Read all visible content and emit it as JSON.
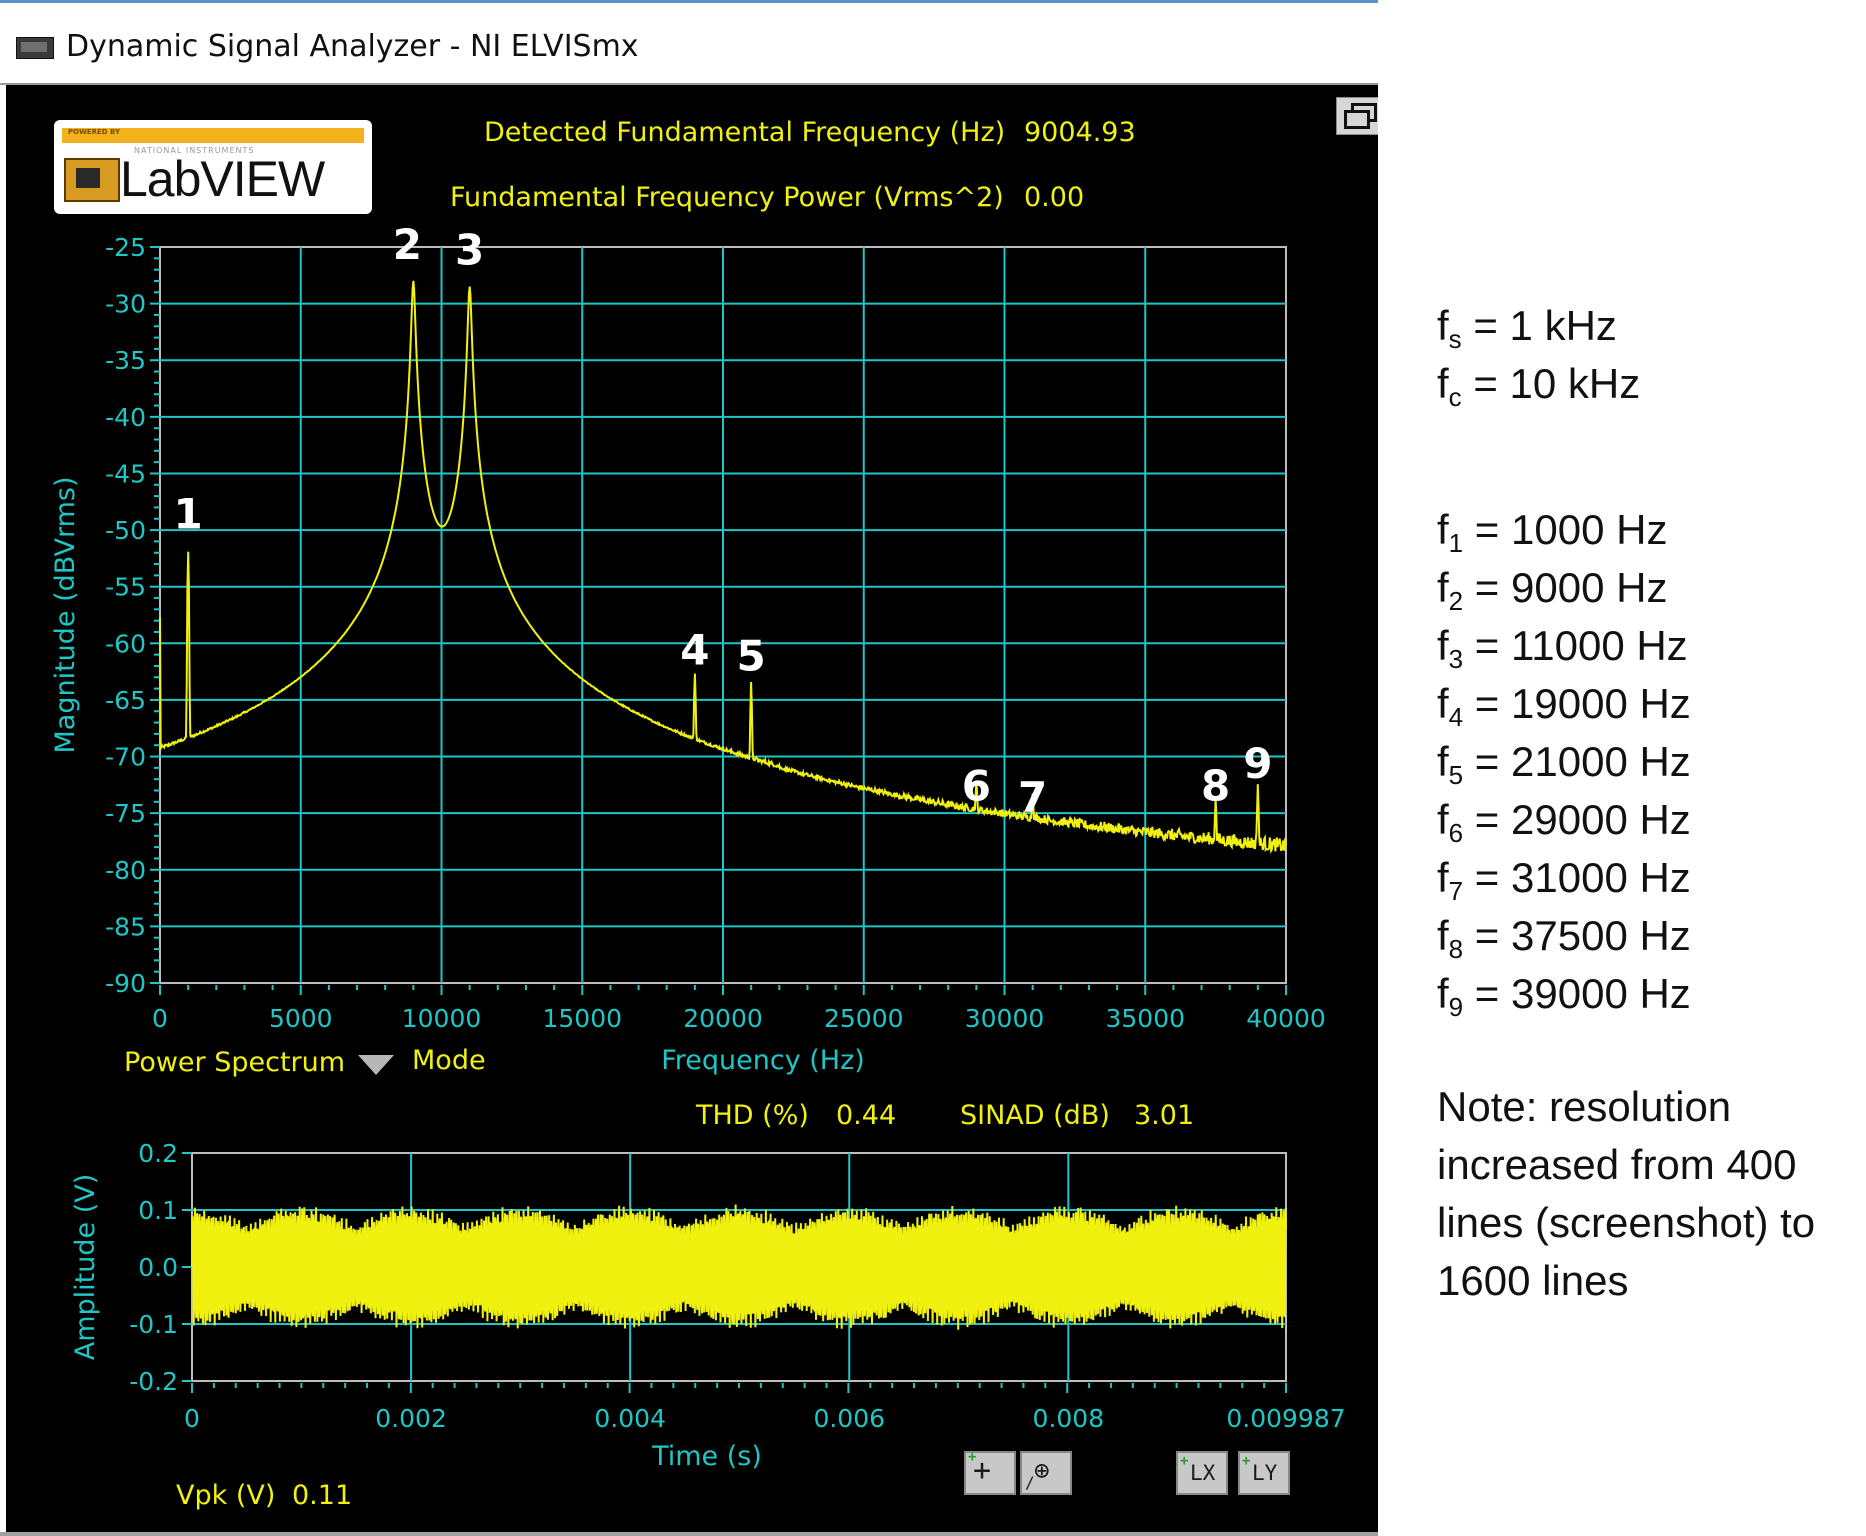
{
  "window": {
    "title": "Dynamic Signal Analyzer - NI ELVISmx",
    "app_icon": "elvis-window-icon",
    "restore_icon": "restore-window-icon"
  },
  "logo": {
    "powered_by": "POWERED BY",
    "vendor": "NATIONAL INSTRUMENTS",
    "brand": "LabVIEW"
  },
  "readouts": {
    "fundamental_freq_label": "Detected Fundamental Frequency (Hz)",
    "fundamental_freq_value": "9004.93",
    "fundamental_power_label": "Fundamental Frequency Power (Vrms^2)",
    "fundamental_power_value": "0.00",
    "thd_label": "THD (%)",
    "thd_value": "0.44",
    "sinad_label": "SINAD (dB)",
    "sinad_value": "3.01",
    "vpk_label": "Vpk (V)",
    "vpk_value": "0.11"
  },
  "controls": {
    "mode_value": "Power Spectrum",
    "mode_label": "Mode"
  },
  "colors": {
    "background": "#000000",
    "grid": "#1fc6c6",
    "trace": "#f1f10f",
    "label_yellow": "#f1f10f",
    "axis_cyan": "#1fc6c6"
  },
  "chart_data": [
    {
      "type": "line",
      "xlabel": "Frequency (Hz)",
      "ylabel": "Magnitude (dBVrms)",
      "xlim": [
        0,
        40000
      ],
      "ylim": [
        -90,
        -25
      ],
      "x_ticks": [
        "0",
        "5000",
        "10000",
        "15000",
        "20000",
        "25000",
        "30000",
        "35000",
        "40000"
      ],
      "y_ticks": [
        "-25",
        "-30",
        "-35",
        "-40",
        "-45",
        "-50",
        "-55",
        "-60",
        "-65",
        "-70",
        "-75",
        "-80",
        "-85",
        "-90"
      ],
      "grid": true,
      "noise_floor": -82,
      "peaks": [
        {
          "label": "1",
          "x": 1000,
          "y": -52
        },
        {
          "label": "2",
          "x": 9000,
          "y": -28
        },
        {
          "label": "3",
          "x": 11000,
          "y": -28.5
        },
        {
          "label": "4",
          "x": 19000,
          "y": -64
        },
        {
          "label": "5",
          "x": 21000,
          "y": -64.5
        },
        {
          "label": "6",
          "x": 29000,
          "y": -76
        },
        {
          "label": "7",
          "x": 31000,
          "y": -77
        },
        {
          "label": "8",
          "x": 37500,
          "y": -76
        },
        {
          "label": "9",
          "x": 39000,
          "y": -74
        }
      ]
    },
    {
      "type": "line",
      "xlabel": "Time (s)",
      "ylabel": "Amplitude (V)",
      "xlim": [
        0,
        0.009987
      ],
      "ylim": [
        -0.2,
        0.2
      ],
      "x_ticks": [
        "0",
        "0.002",
        "0.004",
        "0.006",
        "0.008",
        "0.009987"
      ],
      "y_ticks": [
        "0.2",
        "0.1",
        "0.0",
        "-0.1",
        "-0.2"
      ],
      "grid": true,
      "amplitude": 0.11,
      "carrier_hz": 10000,
      "modulation_hz": 1000
    }
  ],
  "toolbar": {
    "cursor_tool": "cursor-tool-icon",
    "zoom_tool": "zoom-tool-icon",
    "x_autoscale_label": "LX",
    "y_autoscale_label": "LY"
  },
  "annotations": {
    "fs": {
      "sym": "f",
      "sub": "s",
      "rest": " = 1 kHz"
    },
    "fc": {
      "sym": "f",
      "sub": "c",
      "rest": " = 10 kHz"
    },
    "freqs": [
      {
        "sym": "f",
        "sub": "1",
        "rest": " = 1000 Hz"
      },
      {
        "sym": "f",
        "sub": "2",
        "rest": " =  9000 Hz"
      },
      {
        "sym": "f",
        "sub": "3",
        "rest": " = 11000 Hz"
      },
      {
        "sym": "f",
        "sub": "4",
        "rest": " = 19000 Hz"
      },
      {
        "sym": "f",
        "sub": "5",
        "rest": " = 21000 Hz"
      },
      {
        "sym": "f",
        "sub": "6",
        "rest": " = 29000 Hz"
      },
      {
        "sym": "f",
        "sub": "7",
        "rest": " = 31000 Hz"
      },
      {
        "sym": "f",
        "sub": "8",
        "rest": " = 37500 Hz"
      },
      {
        "sym": "f",
        "sub": "9",
        "rest": " = 39000 Hz"
      }
    ],
    "note": "Note: resolution increased from 400 lines (screenshot) to 1600 lines"
  }
}
